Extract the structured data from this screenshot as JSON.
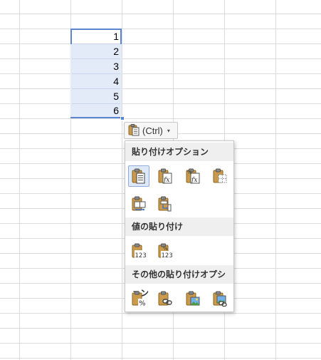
{
  "cells": [
    "1",
    "2",
    "3",
    "4",
    "5",
    "6"
  ],
  "paste_button": {
    "label": "(Ctrl)",
    "icon": "clipboard-icon",
    "caret": "▾"
  },
  "menu": {
    "sections": [
      {
        "title": "貼り付けオプション",
        "icons": [
          "paste-icon",
          "paste-formulas-icon",
          "paste-formulas-number-format-icon",
          "paste-no-borders-icon",
          "paste-keep-column-widths-icon",
          "paste-transpose-icon"
        ]
      },
      {
        "title": "値の貼り付け",
        "icons": [
          "paste-values-icon",
          "paste-values-number-format-icon"
        ]
      },
      {
        "title": "その他の貼り付けオプション",
        "icons": [
          "paste-formatting-icon",
          "paste-link-icon",
          "paste-picture-icon",
          "paste-linked-picture-icon"
        ]
      }
    ]
  },
  "colors": {
    "selection": "#5b85cf",
    "highlight": "#e3ebf8",
    "menu_header": "#efefef"
  }
}
